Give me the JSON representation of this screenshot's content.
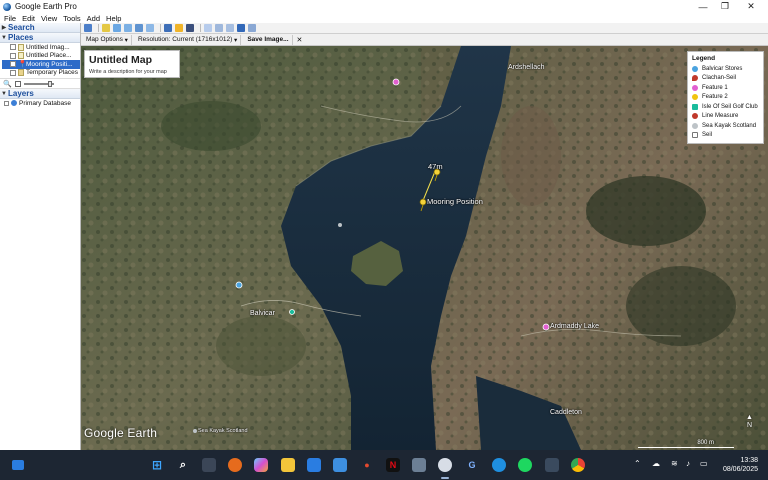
{
  "window": {
    "title": "Google Earth Pro",
    "controls": {
      "minimize": "—",
      "maximize": "❐",
      "close": "✕"
    }
  },
  "menu": [
    "File",
    "Edit",
    "View",
    "Tools",
    "Add",
    "Help"
  ],
  "left_panel": {
    "search_header": "Search",
    "places_header": "Places",
    "places_items": [
      {
        "label": "Untitled Imag...",
        "icon": "document-icon",
        "selected": false
      },
      {
        "label": "Untitled Place...",
        "icon": "document-icon",
        "selected": false
      },
      {
        "label": "Mooring Positi...",
        "icon": "pushpin-icon",
        "selected": true
      },
      {
        "label": "Temporary Places",
        "icon": "folder-icon",
        "selected": false
      }
    ],
    "layers_header": "Layers",
    "layers_items": [
      {
        "label": "Primary Database",
        "icon": "globe-icon"
      }
    ]
  },
  "save_bar": {
    "map_options": "Map Options",
    "resolution": "Resolution: Current (1716x1012)",
    "save_image": "Save Image...",
    "close": "✕"
  },
  "map_title_card": {
    "title": "Untitled Map",
    "description": "Write a description for your map"
  },
  "legend": {
    "title": "Legend",
    "items": [
      {
        "label": "Balvicar Stores",
        "color": "#4aa3df"
      },
      {
        "label": "Clachan-Seil",
        "color": "#c0392b"
      },
      {
        "label": "Feature 1",
        "color": "#e25fd0"
      },
      {
        "label": "Feature 2",
        "color": "#f1c40f"
      },
      {
        "label": "Isle Of Seil Golf Club",
        "color": "#1abc9c"
      },
      {
        "label": "Line Measure",
        "color": "#c0392b"
      },
      {
        "label": "Sea Kayak Scotland",
        "color": "#bdc3c7"
      },
      {
        "label": "Seil",
        "color": "#7f8c8d"
      }
    ]
  },
  "map_labels": {
    "ardshellach": "Ardshellach",
    "distance": "47m",
    "mooring": "Mooring Position",
    "balvicar": "Balvicar",
    "ardmaddy": "Ardmaddy Lake",
    "caddleton": "Caddleton",
    "kayak": "Sea Kayak Scotland",
    "brand": "Google Earth",
    "scale": "800 m",
    "north": "N"
  },
  "taskbar": {
    "time": "13:38",
    "date": "08/06/2025"
  }
}
